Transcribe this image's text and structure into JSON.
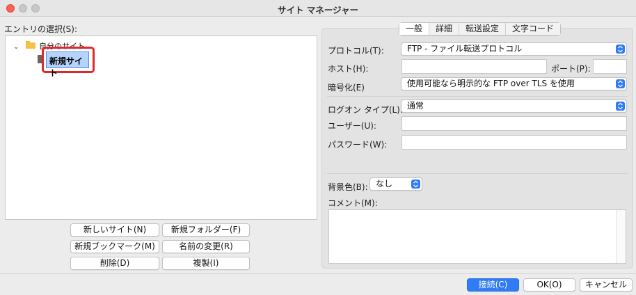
{
  "window": {
    "title": "サイト マネージャー"
  },
  "entries": {
    "label": "エントリの選択(S):",
    "folder_label": "自分のサイト",
    "selected_site": "新規サイト"
  },
  "left_buttons": {
    "new_site": "新しいサイト(N)",
    "new_folder": "新規フォルダー(F)",
    "new_bookmark": "新規ブックマーク(M)",
    "rename": "名前の変更(R)",
    "delete": "削除(D)",
    "duplicate": "複製(I)"
  },
  "tabs": [
    "一般",
    "詳細",
    "転送設定",
    "文字コード"
  ],
  "form": {
    "protocol_label": "プロトコル(T):",
    "protocol_value": "FTP - ファイル転送プロトコル",
    "host_label": "ホスト(H):",
    "host_value": "",
    "port_label": "ポート(P):",
    "port_value": "",
    "encryption_label": "暗号化(E)",
    "encryption_value": "使用可能なら明示的な FTP over TLS を使用",
    "logon_type_label": "ログオン タイプ(L):",
    "logon_type_value": "通常",
    "user_label": "ユーザー(U):",
    "user_value": "",
    "password_label": "パスワード(W):",
    "password_value": "",
    "background_label": "背景色(B):",
    "background_value": "なし",
    "comment_label": "コメント(M):",
    "comment_value": ""
  },
  "footer": {
    "connect": "接続(C)",
    "ok": "OK(O)",
    "cancel": "キャンセル"
  },
  "colors": {
    "accent": "#2f7cf6",
    "highlight_border": "#e5262a",
    "folder": "#f7c04a"
  }
}
